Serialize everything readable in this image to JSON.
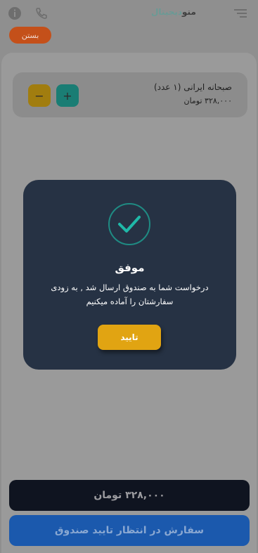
{
  "header": {
    "logo_part1": "منو",
    "logo_part2": "دیجیتال",
    "close_label": "بستن",
    "icons": [
      "info-icon",
      "phone-icon",
      "menu-icon"
    ]
  },
  "cart": {
    "items": [
      {
        "name": "صبحانه ایرانی (۱ عدد)",
        "price": "۳۲۸,۰۰۰ تومان",
        "plus": "+",
        "minus": "−"
      }
    ]
  },
  "modal": {
    "icon": "check-icon",
    "title": "موفق",
    "message": "درخواست شما به صندوق ارسال شد , به زودی سفارشتان را آماده میکنیم",
    "confirm_label": "تایید"
  },
  "footer": {
    "total": "۳۲۸,۰۰۰ تومان",
    "status": "سفارش در انتظار تایید صندوق"
  },
  "colors": {
    "modal_bg": "#263244",
    "accent_yellow": "#e1a412",
    "success_teal": "#1f8b83",
    "status_blue": "#1b59ad",
    "close_orange": "#c4501a"
  }
}
